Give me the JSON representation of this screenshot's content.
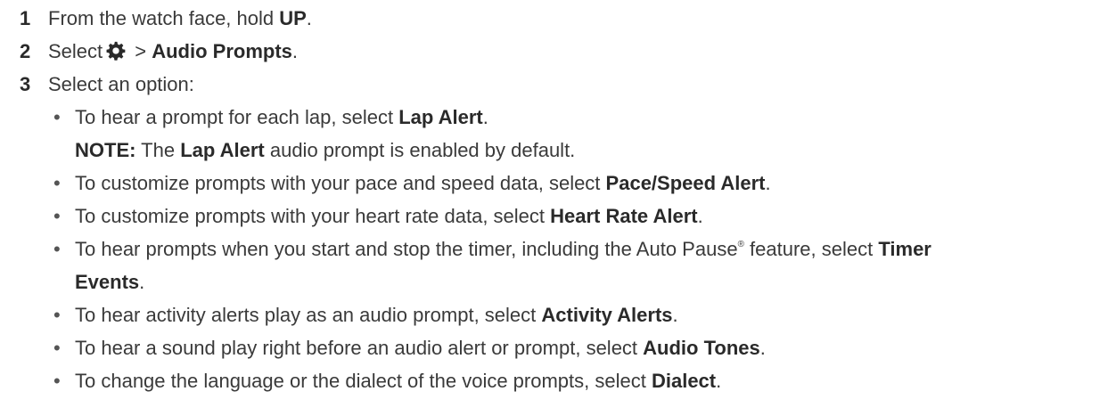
{
  "steps": [
    {
      "num": "1",
      "pre": "From the watch face, hold ",
      "bold": "UP",
      "post": "."
    },
    {
      "num": "2",
      "pre": "Select",
      "sep": " > ",
      "bold": "Audio Prompts",
      "post": ".",
      "icon": "gear-icon"
    },
    {
      "num": "3",
      "text": "Select an option:"
    }
  ],
  "bullets": [
    {
      "pre": "To hear a prompt for each lap, select ",
      "bold": "Lap Alert",
      "post": "."
    },
    {
      "pre": "To customize prompts with your pace and speed data, select ",
      "bold": "Pace/Speed Alert",
      "post": "."
    },
    {
      "pre": "To customize prompts with your heart rate data, select ",
      "bold": "Heart Rate Alert",
      "post": "."
    },
    {
      "pre": "To hear prompts when you start and stop the timer, including the Auto Pause",
      "sup": "®",
      "mid": " feature, select ",
      "bold": "Timer",
      "bold2": "Events",
      "post": "."
    },
    {
      "pre": "To hear activity alerts play as an audio prompt, select ",
      "bold": "Activity Alerts",
      "post": "."
    },
    {
      "pre": "To hear a sound play right before an audio alert or prompt, select ",
      "bold": "Audio Tones",
      "post": "."
    },
    {
      "pre": "To change the language or the dialect of the voice prompts, select ",
      "bold": "Dialect",
      "post": "."
    }
  ],
  "note": {
    "label": "NOTE:",
    "pre": " The ",
    "bold": "Lap Alert",
    "post": " audio prompt is enabled by default."
  },
  "bullet_char": "•"
}
